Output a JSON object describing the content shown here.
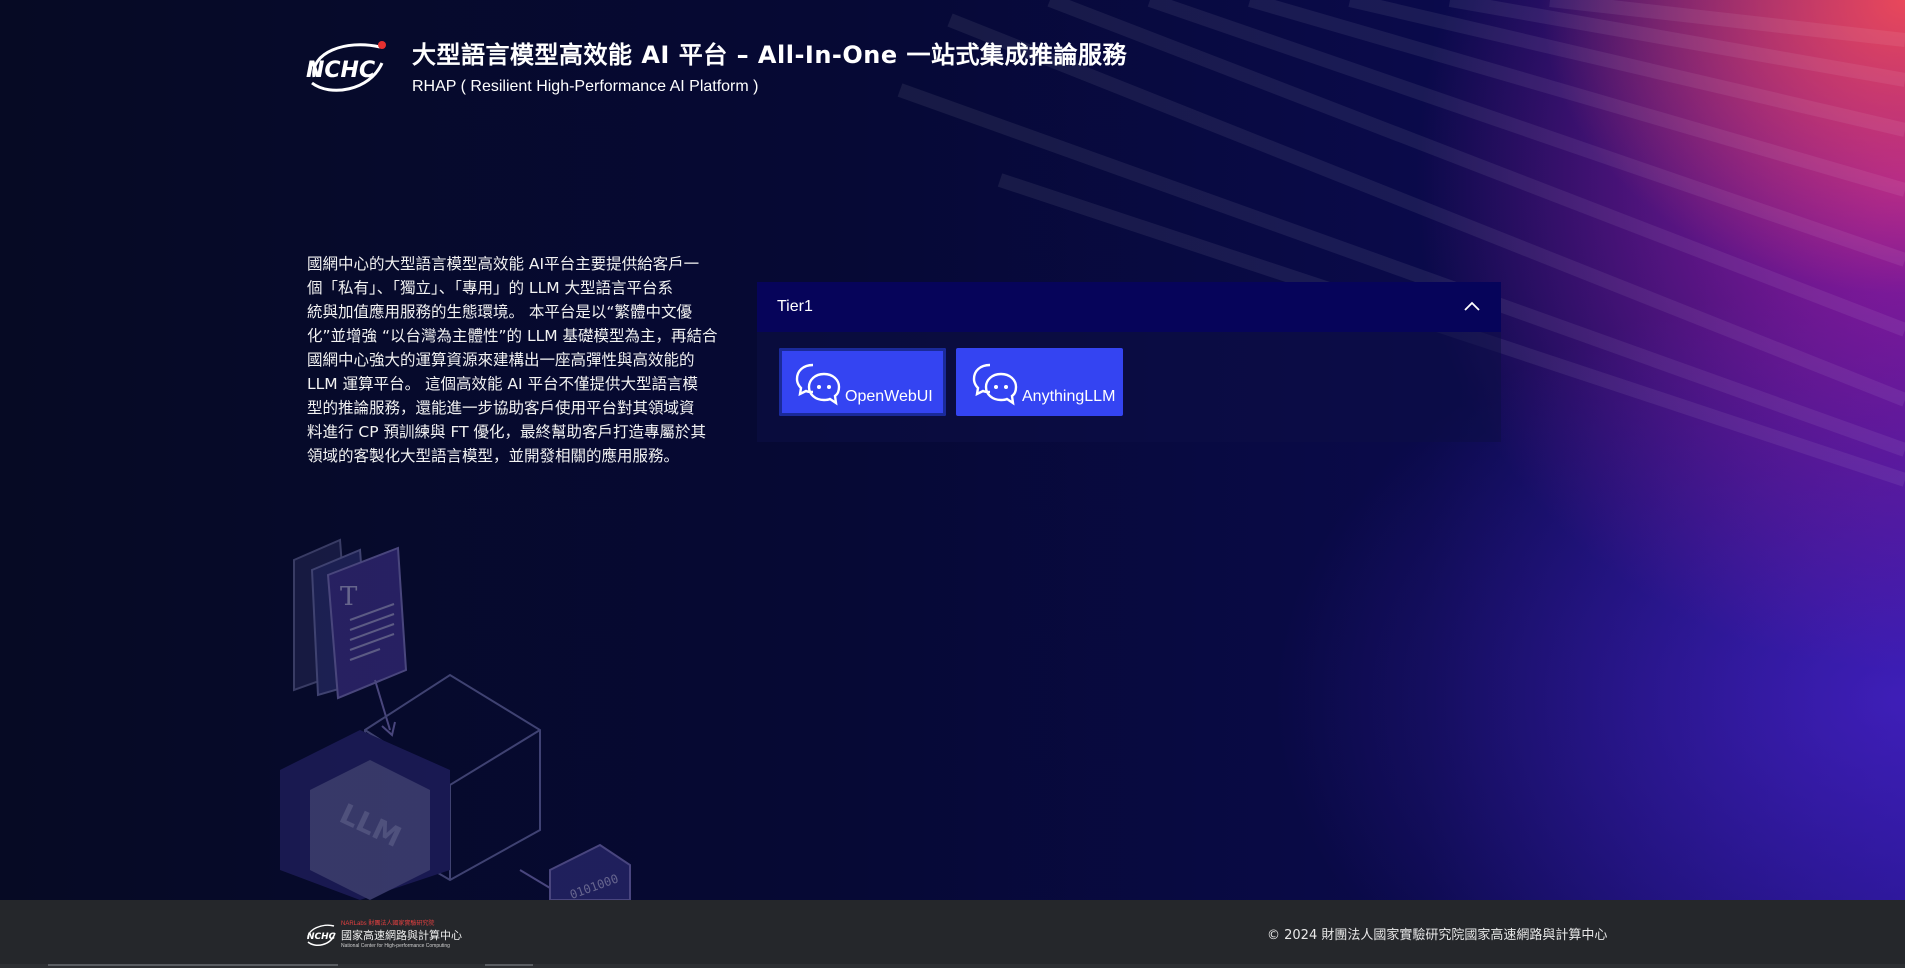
{
  "header": {
    "logo_text": "NCHC",
    "title": "大型語言模型高效能 AI 平台 – All-In-One 一站式集成推論服務",
    "subtitle": "RHAP ( Resilient High-Performance AI Platform )"
  },
  "description": {
    "lines": [
      "國網中心的大型語言模型高效能 AI平台主要提供給客戶一",
      "個「私有」、「獨立」、「專用」的 LLM 大型語言平台系",
      "統與加值應用服務的生態環境。 本平台是以“繁體中文優",
      "化”並增強 “以台灣為主體性”的 LLM 基礎模型為主，再結合",
      "國網中心強大的運算資源來建構出一座高彈性與高效能的",
      "LLM 運算平台。 這個高效能 AI 平台不僅提供大型語言模",
      "型的推論服務，還能進一步協助客戶使用平台對其領域資",
      "料進行 CP 預訓練與 FT 優化，最終幫助客戶打造專屬於其",
      "領域的客製化大型語言模型，並開發相關的應用服務。"
    ]
  },
  "tier": {
    "label": "Tier1",
    "expanded": true,
    "apps": [
      {
        "label": "OpenWebUI",
        "icon": "chat-bubbles-icon",
        "selected": true
      },
      {
        "label": "AnythingLLM",
        "icon": "chat-bubbles-icon",
        "selected": false
      }
    ]
  },
  "illustration": {
    "doc_letter": "T",
    "cube_text": "LLM",
    "binary_text": "0101000"
  },
  "footer": {
    "org_top": "NARLabs 財團法人國家實驗研究院",
    "org_zh": "國家高速網路與計算中心",
    "org_en": "National Center for High-performance Computing",
    "copyright": "© 2024 財團法人國家實驗研究院國家高速網路與計算中心"
  },
  "colors": {
    "accent_button": "#3444f2",
    "tier_header": "#06045a",
    "footer_bg": "#25272b"
  }
}
